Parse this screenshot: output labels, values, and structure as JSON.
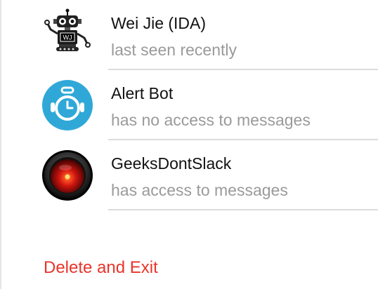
{
  "members": [
    {
      "name": "Wei Jie (IDA)",
      "status": "last seen recently",
      "avatar": "robot-icon",
      "avatar_text": "WJ"
    },
    {
      "name": "Alert Bot",
      "status": "has no access to messages",
      "avatar": "alarm-clock-robot-icon"
    },
    {
      "name": "GeeksDontSlack",
      "status": "has access to messages",
      "avatar": "hal-eye-icon"
    }
  ],
  "actions": {
    "delete_and_exit": "Delete and Exit"
  },
  "colors": {
    "danger": "#e8352a",
    "secondary_text": "#9a9a9a",
    "alert_bot_blue": "#2fa8d8",
    "hal_red": "#e0231c"
  }
}
